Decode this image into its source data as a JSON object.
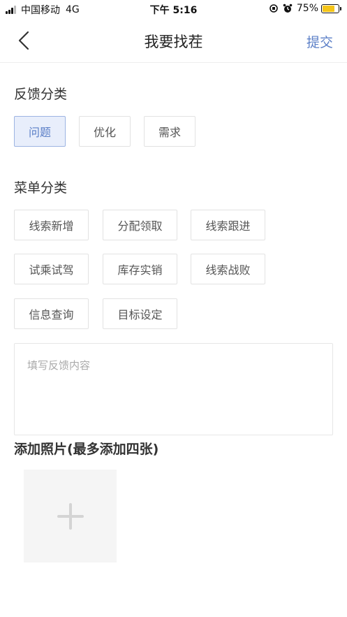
{
  "status_bar": {
    "carrier": "中国移动",
    "network": "4G",
    "time": "下午 5:16",
    "battery": "75%",
    "battery_level": 0.75
  },
  "nav": {
    "title": "我要找茬",
    "submit_label": "提交",
    "accent_color": "#5b7fc7"
  },
  "feedback_category": {
    "title": "反馈分类",
    "options": [
      "问题",
      "优化",
      "需求"
    ],
    "selected": "问题"
  },
  "menu_category": {
    "title": "菜单分类",
    "options": [
      "线索新增",
      "分配领取",
      "线索跟进",
      "试乘试驾",
      "库存实销",
      "线索战败",
      "信息查询",
      "目标设定"
    ]
  },
  "feedback_input": {
    "placeholder": "填写反馈内容"
  },
  "photos": {
    "title": "添加照片(最多添加四张)"
  },
  "icons": {
    "back": "chevron-left-icon",
    "add": "plus-icon"
  }
}
